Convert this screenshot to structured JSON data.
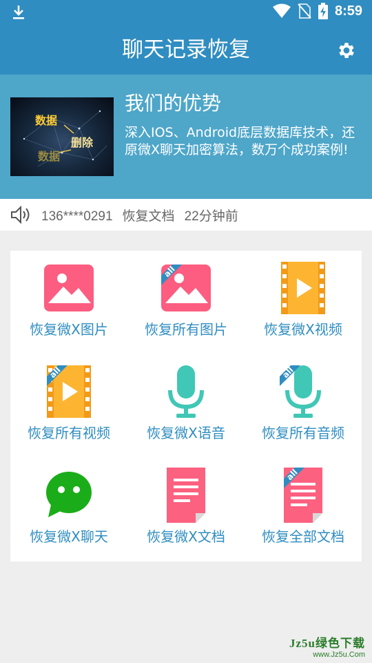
{
  "status_bar": {
    "time": "8:59",
    "icons": [
      "download-icon",
      "wifi-icon",
      "no-sim-icon",
      "battery-charging-icon"
    ]
  },
  "app_bar": {
    "title": "聊天记录恢复",
    "settings_icon": "gear-icon"
  },
  "hero": {
    "image_words": [
      "数据",
      "删除",
      "数据"
    ],
    "title": "我们的优势",
    "description": "深入IOS、Android底层数据库技术，还原微X聊天加密算法，数万个成功案例!"
  },
  "notice": {
    "icon": "speaker-icon",
    "phone": "136****0291",
    "action": "恢复文档",
    "time_ago": "22分钟前"
  },
  "features": [
    {
      "label": "恢复微X图片",
      "icon": "image-icon"
    },
    {
      "label": "恢复所有图片",
      "icon": "image-all-icon",
      "badge": "all"
    },
    {
      "label": "恢复微X视频",
      "icon": "video-icon"
    },
    {
      "label": "恢复所有视频",
      "icon": "video-all-icon",
      "badge": "all"
    },
    {
      "label": "恢复微X语音",
      "icon": "microphone-icon"
    },
    {
      "label": "恢复所有音频",
      "icon": "microphone-all-icon",
      "badge": "all"
    },
    {
      "label": "恢复微X聊天",
      "icon": "chat-bubble-icon"
    },
    {
      "label": "恢复微X文档",
      "icon": "document-icon"
    },
    {
      "label": "恢复全部文档",
      "icon": "document-all-icon",
      "badge": "all"
    }
  ],
  "watermark": {
    "line1": "Jz5u绿色下载",
    "line2": "www.Jz5u.Com"
  },
  "colors": {
    "primary": "#2f8dc1",
    "hero_bg": "#4ea6c9",
    "pink": "#fc5d80",
    "video_yellow": "#fdb531",
    "teal": "#40c7b5",
    "chat_green": "#1aad19",
    "doc_pink": "#fc6180"
  }
}
